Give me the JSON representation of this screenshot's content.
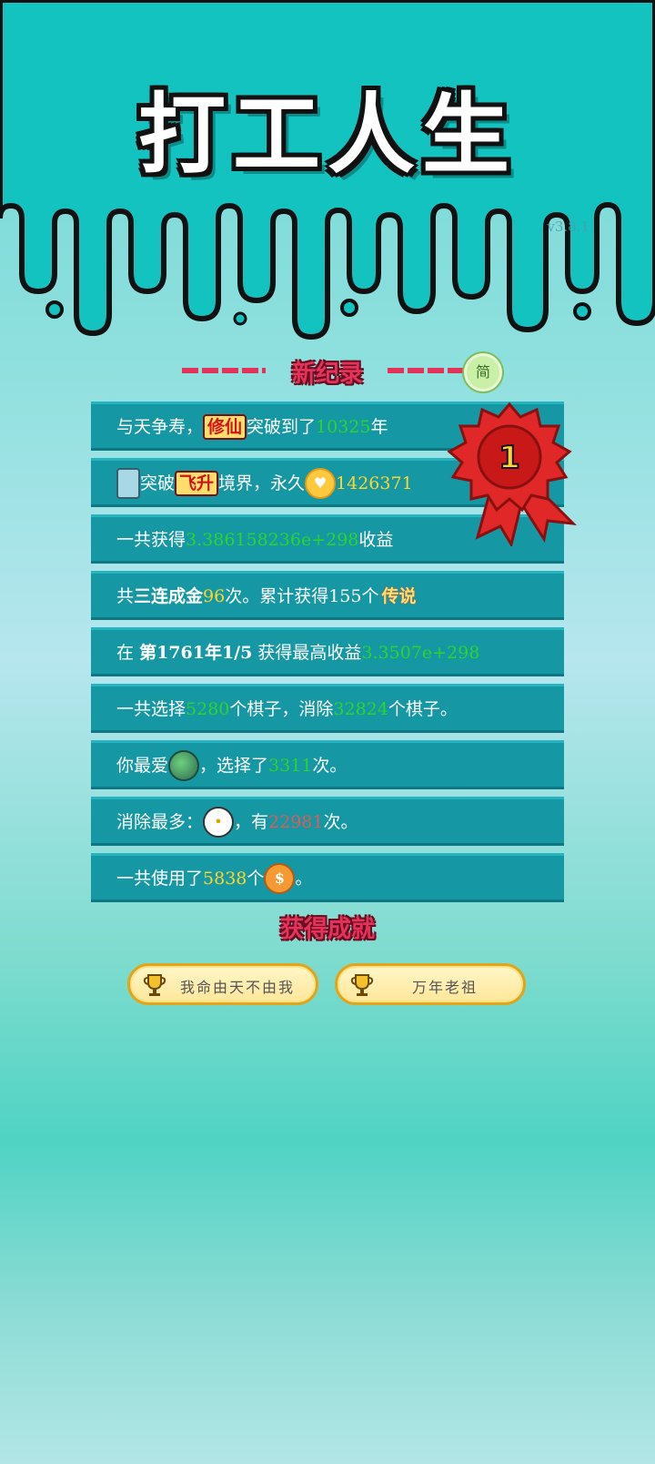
{
  "game": {
    "title": "打工人生",
    "version": "v3.8.1",
    "simplify_label": "简"
  },
  "records": {
    "header": "新纪录",
    "rows": [
      {
        "prefix": "与天争寿，",
        "tag": "修仙",
        "mid": "突破到了",
        "value": "10325",
        "suffix": "年"
      },
      {
        "prefix": "突破",
        "tag": "飞升",
        "mid": "境界，永久",
        "value": "1426371"
      },
      {
        "prefix": "一共获得",
        "value": "3.386158236e+298",
        "suffix": "收益"
      },
      {
        "prefix": "共",
        "bold": "三连成金",
        "value": "96",
        "mid": "次。累计获得155个",
        "tag": "传说"
      },
      {
        "prefix": "在",
        "bold": "第1761年1/5",
        "mid": "获得最高收益",
        "value": "3.3507e+298"
      },
      {
        "prefix": "一共选择",
        "value": "5280",
        "mid": "个棋子，消除",
        "value2": "32824",
        "suffix": "个棋子。"
      },
      {
        "prefix": "你最爱",
        "mid": "，选择了",
        "value": "3311",
        "suffix": "次。"
      },
      {
        "prefix": "消除最多：",
        "mid": "，有",
        "value": "22981",
        "suffix": "次。"
      },
      {
        "prefix": "一共使用了",
        "value": "5838",
        "mid": "个",
        "suffix": "。"
      }
    ],
    "rank_badge": "1"
  },
  "achievements": {
    "header": "获得成就",
    "items": [
      "我命由天不由我",
      "万年老祖"
    ]
  },
  "colors": {
    "header_red": "#e4335a",
    "row_bg": "#1597a4",
    "value_green": "#2bd52b",
    "value_yellow": "#ffd52b",
    "value_red": "#e35a52"
  }
}
